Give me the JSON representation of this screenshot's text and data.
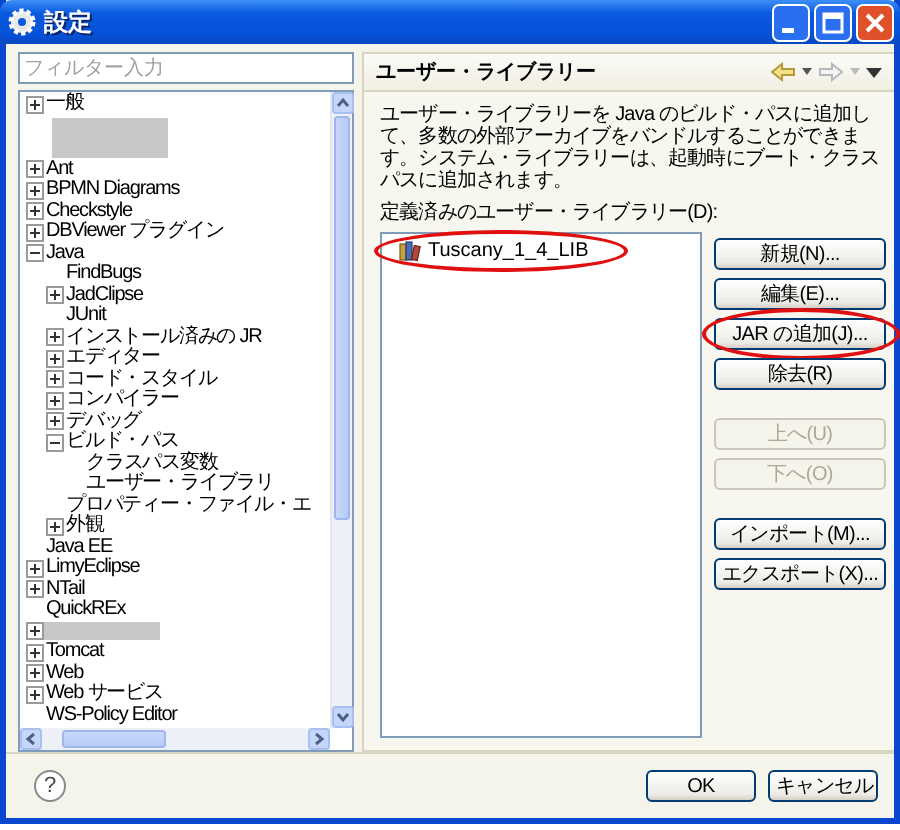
{
  "window": {
    "title": "設定"
  },
  "filter": {
    "placeholder": "フィルター入力"
  },
  "tree": [
    {
      "label": "一般",
      "kind": "branch",
      "expanded": false
    },
    {
      "kind": "redacted"
    },
    {
      "label": "Ant",
      "kind": "branch",
      "expanded": false
    },
    {
      "label": "BPMN Diagrams",
      "kind": "branch",
      "expanded": false
    },
    {
      "label": "Checkstyle",
      "kind": "branch",
      "expanded": false
    },
    {
      "label": "DBViewer プラグイン",
      "kind": "branch",
      "expanded": false
    },
    {
      "label": "Java",
      "kind": "branch",
      "expanded": true,
      "children": [
        {
          "label": "FindBugs",
          "kind": "leaf"
        },
        {
          "label": "JadClipse",
          "kind": "branch",
          "expanded": false
        },
        {
          "label": "JUnit",
          "kind": "leaf"
        },
        {
          "label": "インストール済みの JR",
          "kind": "branch",
          "expanded": false
        },
        {
          "label": "エディター",
          "kind": "branch",
          "expanded": false
        },
        {
          "label": "コード・スタイル",
          "kind": "branch",
          "expanded": false
        },
        {
          "label": "コンパイラー",
          "kind": "branch",
          "expanded": false
        },
        {
          "label": "デバッグ",
          "kind": "branch",
          "expanded": false
        },
        {
          "label": "ビルド・パス",
          "kind": "branch",
          "expanded": true,
          "children": [
            {
              "label": "クラスパス変数",
              "kind": "leaf"
            },
            {
              "label": "ユーザー・ライブラリ",
              "kind": "leaf"
            }
          ]
        },
        {
          "label": "プロパティー・ファイル・エ",
          "kind": "leaf"
        },
        {
          "label": "外観",
          "kind": "branch",
          "expanded": false
        }
      ]
    },
    {
      "label": "Java EE",
      "kind": "leaf"
    },
    {
      "label": "LimyEclipse",
      "kind": "branch",
      "expanded": false
    },
    {
      "label": "NTail",
      "kind": "branch",
      "expanded": false
    },
    {
      "label": "QuickREx",
      "kind": "leaf"
    },
    {
      "kind": "redacted-branch",
      "expanded": false
    },
    {
      "label": "Tomcat",
      "kind": "branch",
      "expanded": false
    },
    {
      "label": "Web",
      "kind": "branch",
      "expanded": false
    },
    {
      "label": "Web サービス",
      "kind": "branch",
      "expanded": false
    },
    {
      "label": "WS-Policy Editor",
      "kind": "leaf"
    }
  ],
  "page": {
    "title": "ユーザー・ライブラリー",
    "description": "ユーザー・ライブラリーを Java のビルド・パスに追加して、多数の外部アーカイブをバンドルすることができます。システム・ライブラリーは、起動時にブート・クラスパスに追加されます。",
    "list_label": "定義済みのユーザー・ライブラリー(D):",
    "libraries": [
      {
        "name": "Tuscany_1_4_LIB",
        "circled": true
      }
    ],
    "buttons": [
      {
        "label": "新規(N)...",
        "disabled": false,
        "circled": false
      },
      {
        "label": "編集(E)...",
        "disabled": false,
        "circled": false
      },
      {
        "label": "JAR の追加(J)...",
        "disabled": false,
        "circled": true
      },
      {
        "label": "除去(R)",
        "disabled": false,
        "circled": false
      },
      {
        "label": "上へ(U)",
        "disabled": true,
        "circled": false
      },
      {
        "label": "下へ(O)",
        "disabled": true,
        "circled": false
      },
      {
        "label": "インポート(M)...",
        "disabled": false,
        "circled": false
      },
      {
        "label": "エクスポート(X)...",
        "disabled": false,
        "circled": false
      }
    ]
  },
  "footer": {
    "help": "?",
    "buttons": [
      {
        "label": "OK"
      },
      {
        "label": "キャンセル"
      }
    ]
  }
}
